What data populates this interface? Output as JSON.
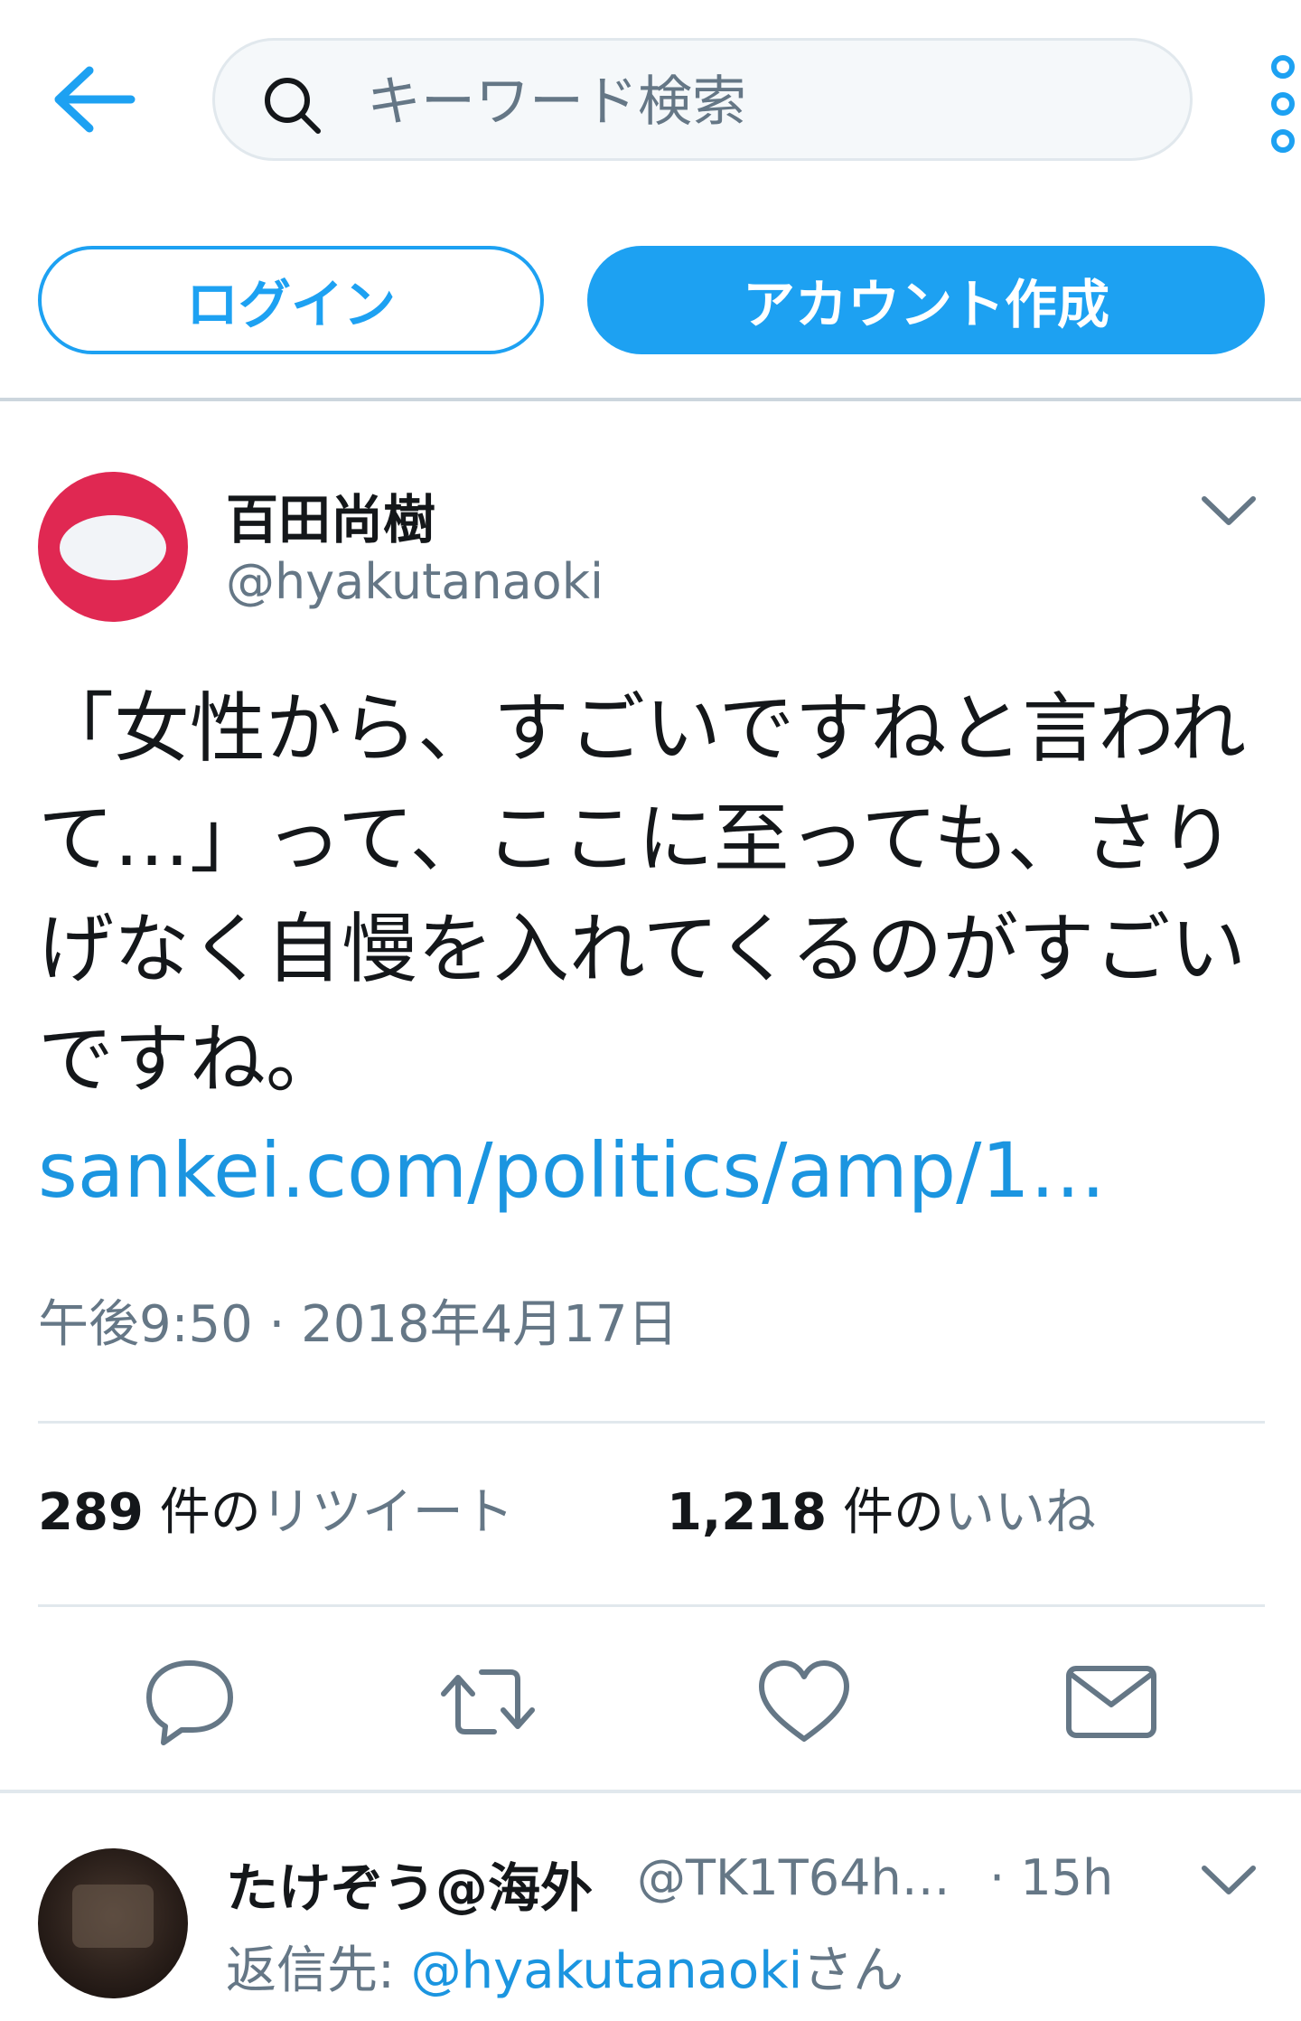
{
  "header": {
    "search_placeholder": "キーワード検索",
    "back_icon": "arrow-left-icon",
    "more_icon": "vertical-dots-icon"
  },
  "auth": {
    "login_label": "ログイン",
    "signup_label": "アカウント作成"
  },
  "tweet": {
    "display_name": "百田尚樹",
    "username": "@hyakutanaoki",
    "text": "「女性から、すごいですねと言われて…」って、ここに至っても、さりげなく自慢を入れてくるのがすごいですね。",
    "link": "sankei.com/politics/amp/1…",
    "timestamp": "午後9:50 · 2018年4月17日",
    "stats": {
      "retweets_count": "289",
      "retweets_unit": "件の",
      "retweets_label": "リツイート",
      "likes_count": "1,218",
      "likes_unit": "件の",
      "likes_label": "いいね"
    },
    "actions": [
      "reply-icon",
      "retweet-icon",
      "like-icon",
      "message-icon"
    ]
  },
  "reply": {
    "display_name": "たけぞう@海外",
    "handle": "@TK1T64h…",
    "time": "· 15h",
    "reply_to_prefix": "返信先: ",
    "reply_to_mention": "@hyakutanaoki",
    "reply_to_suffix": "さん"
  },
  "colors": {
    "accent": "#1da1f2",
    "link": "#1b95e0",
    "secondary_text": "#657786",
    "avatar_bg": "#e02852"
  }
}
